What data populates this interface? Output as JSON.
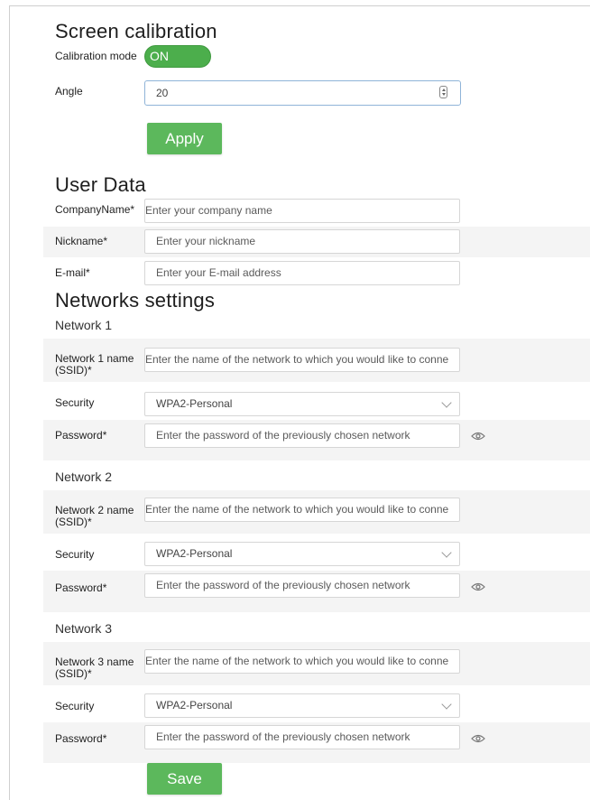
{
  "screen_calibration": {
    "title": "Screen calibration",
    "mode_label": "Calibration mode",
    "mode_value": "ON",
    "angle_label": "Angle",
    "angle_value": "20",
    "apply_label": "Apply"
  },
  "user_data": {
    "title": "User Data",
    "company_label": "CompanyName*",
    "company_placeholder": "Enter your company name",
    "nickname_label": "Nickname*",
    "nickname_placeholder": "Enter your nickname",
    "email_label": "E-mail*",
    "email_placeholder": "Enter your E-mail address"
  },
  "networks": {
    "title": "Networks settings",
    "items": [
      {
        "heading": "Network 1",
        "name_label_1": "Network 1 name",
        "name_label_2": "(SSID)*",
        "ssid_placeholder": "Enter the name of the network to which you would like to conne",
        "security_label": "Security",
        "security_value": "WPA2-Personal",
        "password_label": "Password*",
        "password_placeholder": "Enter the password of the previously chosen network"
      },
      {
        "heading": "Network 2",
        "name_label_1": "Network 2 name",
        "name_label_2": "(SSID)*",
        "ssid_placeholder": "Enter the name of the network to which you would like to conne",
        "security_label": "Security",
        "security_value": "WPA2-Personal",
        "password_label": "Password*",
        "password_placeholder": "Enter the password of the previously chosen network"
      },
      {
        "heading": "Network 3",
        "name_label_1": "Network 3 name",
        "name_label_2": "(SSID)*",
        "ssid_placeholder": "Enter the name of the network to which you would like to conne",
        "security_label": "Security",
        "security_value": "WPA2-Personal",
        "password_label": "Password*",
        "password_placeholder": "Enter the password of the previously chosen network"
      }
    ]
  },
  "save_label": "Save",
  "icons": {
    "toggle_password": "eye-icon",
    "select_arrow": "chevron-down-icon",
    "spinner": "spin-buttons-icon"
  },
  "colors": {
    "accent": "#5cb85c",
    "stripe": "#f4f4f4",
    "focus_border": "#8fb4d8"
  }
}
